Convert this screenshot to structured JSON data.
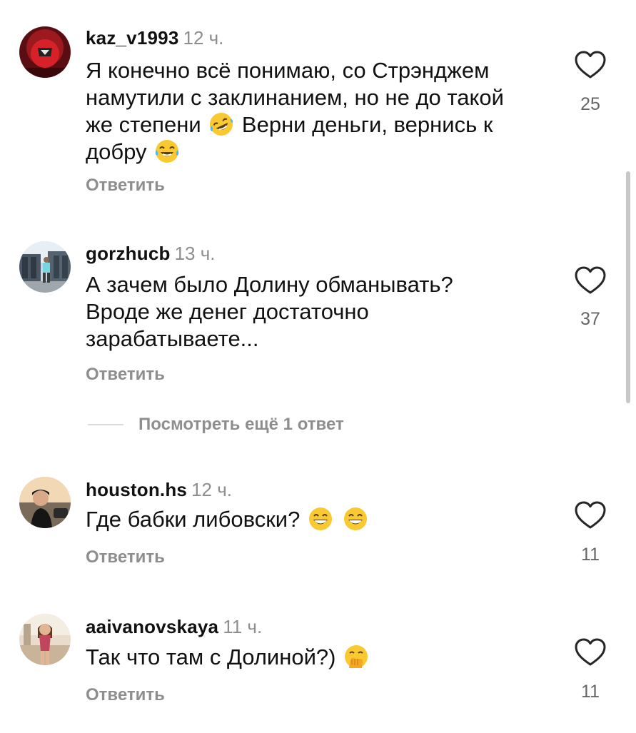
{
  "comments": [
    {
      "username": "kaz_v1993",
      "time": "12 ч.",
      "text_lines": [
        "Я конечно всё понимаю, со Стрэнджем",
        "намутили с заклинанием, но не до такой",
        "же степени",
        "Верни деньги, вернись к",
        "добру"
      ],
      "emojis": [
        "rolling-on-floor-laughing-emoji",
        "tears-of-joy-emoji"
      ],
      "reply": "Ответить",
      "likes": "25"
    },
    {
      "username": "gorzhucb",
      "time": "13 ч.",
      "text_lines": [
        "А зачем было Долину обманывать?",
        "Вроде же денег достаточно",
        "зарабатываете..."
      ],
      "reply": "Ответить",
      "likes": "37",
      "more_replies": "Посмотреть ещё 1 ответ"
    },
    {
      "username": "houston.hs",
      "time": "12 ч.",
      "text": "Где бабки либовски?",
      "emojis": [
        "grinning-face-emoji",
        "grinning-face-emoji"
      ],
      "reply": "Ответить",
      "likes": "11"
    },
    {
      "username": "aaivanovskaya",
      "time": "11 ч.",
      "text": "Так что там с Долиной?)",
      "emojis": [
        "face-with-hand-over-mouth-emoji"
      ],
      "reply": "Ответить",
      "likes": "11"
    }
  ],
  "icons": {
    "like": "heart-outline-icon"
  },
  "colors": {
    "text": "#111111",
    "secondary": "#8e8e8e",
    "likes": "#666666",
    "divider": "#dbdbdb"
  }
}
